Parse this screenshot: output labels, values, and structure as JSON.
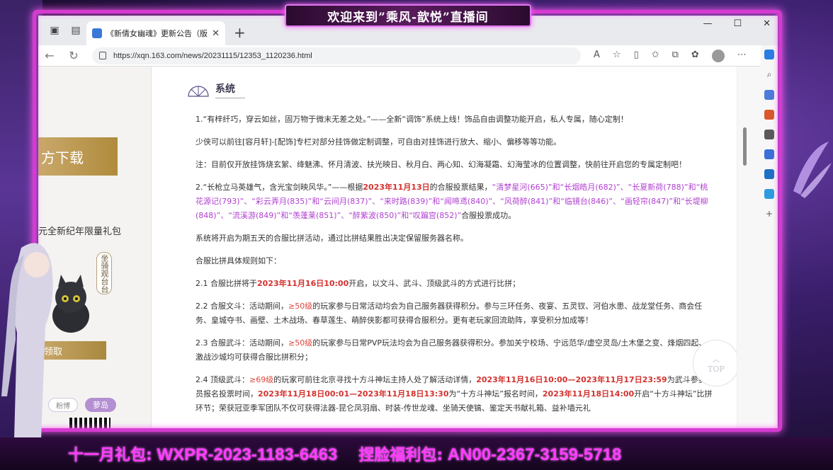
{
  "stream": {
    "banner": "欢迎来到”乘风-歆悦”直播间",
    "bottom_gift_label": "十一月礼包:",
    "bottom_gift_code": "WXPR-2023-1183-6463",
    "bottom_face_label": "捏脸福利包:",
    "bottom_face_code": "AN00-2367-3159-5718"
  },
  "browser": {
    "tab_title": "《新倩女幽魂》更新公告（版本",
    "url": "https://xqn.163.com/news/20231115/12353_1120236.html"
  },
  "left_panel": {
    "download_label": "方下载",
    "gift_text": "元全新纪年限量礼包",
    "vertical_tag": "坐骑观台台",
    "claim_label": "领取",
    "pill_a": "粉博",
    "pill_b": "萝岛"
  },
  "article": {
    "section_title": "系统",
    "p1": "1.“有梓纤巧，穿云如丝，固万物于微末无差之处。”——全新“调饰”系统上线！饰品自由调整功能开启，私人专属，随心定制！",
    "p2": "少侠可以前往[容月轩]-[配饰]专栏对部分挂饰做定制调整，可自由对挂饰进行放大、缩小、偏移等等功能。",
    "p3": "注：目前仅开放挂饰烧玄絮、绛魅沸、怀月清波、扶光映日、秋月白、两心知、幻海凝霜、幻海莹冰的位置调整，快前往开启您的专属定制吧！",
    "p4_a": "2.“长枪立马英雄气，含光宝剑映风华。”——根据",
    "p4_date": "2023年11月13日",
    "p4_b": "的合服投票结果，",
    "p4_servers": "“清梦星河(665)”和“长烟皓月(682)”、“长夏新荷(788)”和“桃花源记(793)”、“彩云弄月(835)”和“云间月(837)”、“来时路(839)”和“闻啼鸢(840)”、“风荷醉(841)”和“临镜台(846)”、“画轻帘(847)”和“长堤柳(848)”、“流溪游(849)”和“羡蓬莱(851)”、“醉紫波(850)”和“叹蹁宫(852)”",
    "p4_c": "合服投票成功。",
    "p5": "系统将开启为期五天的合服比拼活动，通过比拼结果胜出决定保留服务器名称。",
    "p6": "合服比拼具体规则如下：",
    "p7_a": "2.1 合服比拼将于",
    "p7_date": "2023年11月16日10:00",
    "p7_b": "开启，以文斗、武斗、顶级武斗的方式进行比拼；",
    "p8_a": "2.2 合服文斗：活动期间，",
    "p8_lvl": "≥50级",
    "p8_b": "的玩家参与日常活动均会为自己服务器获得积分。参与三环任务、夜宴、五灵钗、河伯水患、战龙堂任务、商会任务、皇城夺书、画壁、土木战场、春草莲生、萌醉侠影都可获得合服积分。更有老玩家回流助阵，享受积分加成等！",
    "p9_a": "2.3 合服武斗：活动期间，",
    "p9_lvl": "≥50级",
    "p9_b": "的玩家参与日常PVP玩法均会为自己服务器获得积分。参加关宁校场、宁远范华/虚空灵岛/土木堡之变、烽烟四起、激战沙城均可获得合服比拼积分；",
    "p10_a": "2.4 顶级武斗：",
    "p10_lvl": "≥69级",
    "p10_b": "的玩家可前往北京寻找十方斗神坛主持人处了解活动详情，",
    "p10_d1": "2023年11月16日10:00—2023年11月17日23:59",
    "p10_c": "为武斗参赛人员报名投票时间，",
    "p10_d2": "2023年11月18日00:01—2023年11月18日13:30",
    "p10_e": "为“十方斗神坛”报名时间，",
    "p10_d3": "2023年11月18日14:00",
    "p10_f": "开启“十方斗神坛”比拼环节；荣获冠亚季军团队不仅可获得法器-昆仑凤羽扇、时装-传世龙魂、坐骑天使镐、鉴定天书献礼箱、益补墙元礼",
    "top_label": "TOP"
  }
}
